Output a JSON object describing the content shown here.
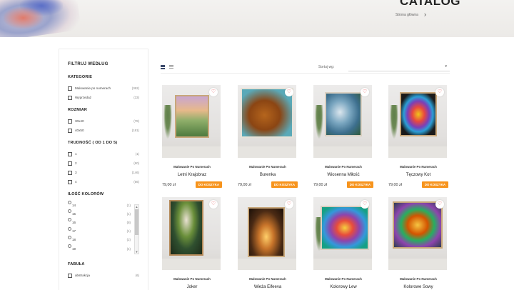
{
  "header": {
    "title": "CATALOG",
    "breadcrumb": "Strona główna",
    "breadcrumb_arrow": "›"
  },
  "sidebar": {
    "title": "FILTRUJ WEDŁUG",
    "categories": {
      "title": "KATEGORIE",
      "options": [
        {
          "label": "Malowanie po numerach",
          "count": "(362)"
        },
        {
          "label": "Wyprzedaż",
          "count": "(33)"
        }
      ]
    },
    "size": {
      "title": "ROZMIAR",
      "options": [
        {
          "label": "30x40",
          "count": "(78)"
        },
        {
          "label": "40x50",
          "count": "(181)"
        }
      ]
    },
    "difficulty": {
      "title": "TRUDNOŚĆ ( OD 1 DO 5)",
      "options": [
        {
          "label": "1",
          "count": "(1)"
        },
        {
          "label": "2",
          "count": "(60)"
        },
        {
          "label": "3",
          "count": "(146)"
        },
        {
          "label": "4",
          "count": "(56)"
        }
      ]
    },
    "colors": {
      "title": "ILOŚĆ KOLORÓW",
      "options": [
        {
          "label": "14",
          "count": "(1)"
        },
        {
          "label": "15",
          "count": "(1)"
        },
        {
          "label": "16",
          "count": "(8)"
        },
        {
          "label": "17",
          "count": "(1)"
        },
        {
          "label": "18",
          "count": "(2)"
        },
        {
          "label": "19",
          "count": "(4)"
        }
      ]
    },
    "style": {
      "title": "FABUŁA",
      "options": [
        {
          "label": "abstrakcja",
          "count": "(6)"
        }
      ]
    }
  },
  "toolbar": {
    "sort_label": "Sortuj wg:",
    "sort_value": "",
    "caret": "▾"
  },
  "products": [
    {
      "category": "Malowanie Po Numerach",
      "name": "Letni Krajobraz",
      "price": "79,00 zł",
      "button": "DO KOSZYKA"
    },
    {
      "category": "Malowanie Po Numerach",
      "name": "Burenka",
      "price": "79,00 zł",
      "button": "DO KOSZYKA"
    },
    {
      "category": "Malowanie Po Numerach",
      "name": "Wiosenna Miłość",
      "price": "79,00 zł",
      "button": "DO KOSZYKA"
    },
    {
      "category": "Malowanie Po Numerach",
      "name": "Tęczowy Kot",
      "price": "79,00 zł",
      "button": "DO KOSZYKA"
    },
    {
      "category": "Malowanie Po Numerach",
      "name": "Joker"
    },
    {
      "category": "Malowanie Po Numerach",
      "name": "Wieża Eifeeva"
    },
    {
      "category": "Malowanie Po Numerach",
      "name": "Kolorowy Lew"
    },
    {
      "category": "Malowanie Po Numerach",
      "name": "Kolorowe Sowy"
    }
  ],
  "colors": {
    "accent": "#f7941d",
    "heart": "#e04848"
  }
}
